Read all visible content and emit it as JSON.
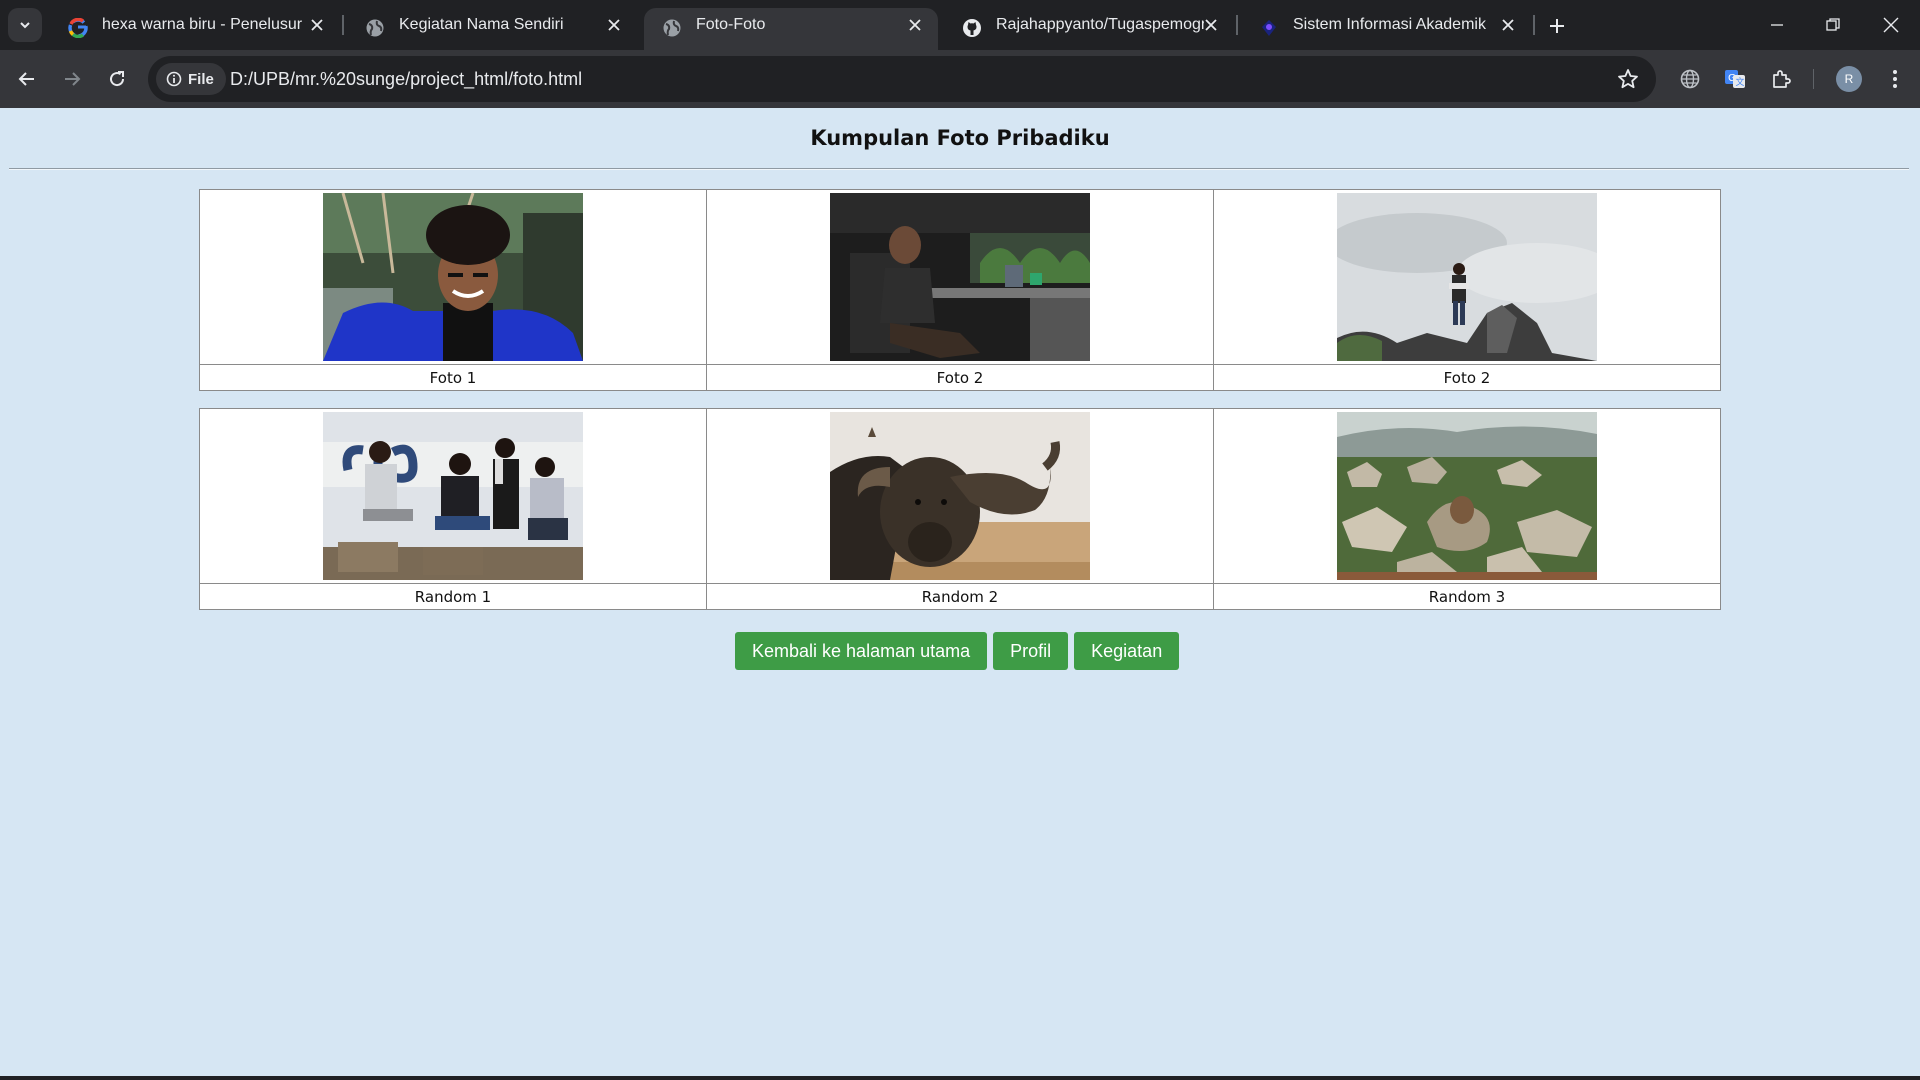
{
  "browser": {
    "tabs": [
      {
        "title": "hexa warna biru - Penelusuran G",
        "favicon": "google-icon",
        "active": false
      },
      {
        "title": "Kegiatan Nama Sendiri",
        "favicon": "globe-icon",
        "active": false
      },
      {
        "title": "Foto-Foto",
        "favicon": "globe-icon",
        "active": true
      },
      {
        "title": "Rajahappyanto/Tugaspemogram",
        "favicon": "github-icon",
        "active": false
      },
      {
        "title": "Sistem Informasi Akademik",
        "favicon": "academic-logo-icon",
        "active": false
      }
    ],
    "address": {
      "chip_label": "File",
      "url": "D:/UPB/mr.%20sunge/project_html/foto.html"
    },
    "profile_initial": "R",
    "colors": {
      "frame": "#202124",
      "toolbar": "#35363a",
      "text": "#e8eaed"
    }
  },
  "page": {
    "title": "Kumpulan Foto Pribadiku",
    "background": "#d6e6f3",
    "gallery": [
      {
        "row": 1,
        "photos": [
          {
            "caption": "Foto 1",
            "alt": "portrait"
          },
          {
            "caption": "Foto 2",
            "alt": "office"
          },
          {
            "caption": "Foto 2",
            "alt": "rock top"
          }
        ]
      },
      {
        "row": 2,
        "photos": [
          {
            "caption": "Random 1",
            "alt": "group"
          },
          {
            "caption": "Random 2",
            "alt": "buffalo"
          },
          {
            "caption": "Random 3",
            "alt": "rocky hill"
          }
        ]
      }
    ],
    "buttons": {
      "home": "Kembali ke halaman utama",
      "profile": "Profil",
      "activity": "Kegiatan",
      "color": "#3e9c46"
    }
  }
}
